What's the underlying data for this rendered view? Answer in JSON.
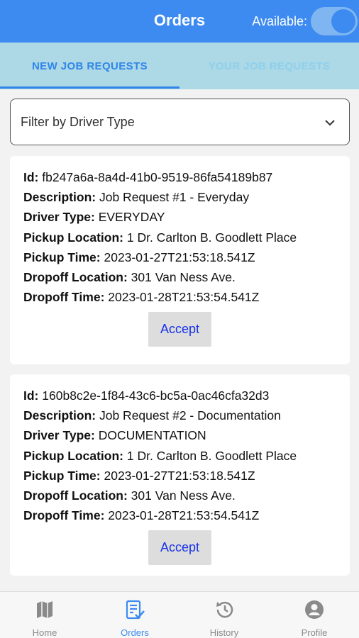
{
  "header": {
    "title": "Orders",
    "available_label": "Available:",
    "available_on": true
  },
  "tabs": [
    {
      "label": "NEW JOB REQUESTS",
      "active": true
    },
    {
      "label": "YOUR JOB REQUESTS",
      "active": false
    }
  ],
  "filter": {
    "placeholder": "Filter by Driver Type"
  },
  "jobs": [
    {
      "id_label": "Id:",
      "id": "fb247a6a-8a4d-41b0-9519-86fa54189b87",
      "description_label": "Description:",
      "description": "Job Request #1 - Everyday",
      "driver_type_label": "Driver Type:",
      "driver_type": "EVERYDAY",
      "pickup_location_label": "Pickup Location:",
      "pickup_location": "1 Dr. Carlton B. Goodlett Place",
      "pickup_time_label": "Pickup Time:",
      "pickup_time": "2023-01-27T21:53:18.541Z",
      "dropoff_location_label": "Dropoff Location:",
      "dropoff_location": "301 Van Ness Ave.",
      "dropoff_time_label": "Dropoff Time:",
      "dropoff_time": "2023-01-28T21:53:54.541Z",
      "accept_label": "Accept"
    },
    {
      "id_label": "Id:",
      "id": "160b8c2e-1f84-43c6-bc5a-0ac46cfa32d3",
      "description_label": "Description:",
      "description": "Job Request #2 - Documentation",
      "driver_type_label": "Driver Type:",
      "driver_type": "DOCUMENTATION",
      "pickup_location_label": "Pickup Location:",
      "pickup_location": "1 Dr. Carlton B. Goodlett Place",
      "pickup_time_label": "Pickup Time:",
      "pickup_time": "2023-01-27T21:53:18.541Z",
      "dropoff_location_label": "Dropoff Location:",
      "dropoff_location": "301 Van Ness Ave.",
      "dropoff_time_label": "Dropoff Time:",
      "dropoff_time": "2023-01-28T21:53:54.541Z",
      "accept_label": "Accept"
    }
  ],
  "bottom_nav": [
    {
      "label": "Home",
      "icon": "map-icon",
      "active": false
    },
    {
      "label": "Orders",
      "icon": "orders-check-icon",
      "active": true
    },
    {
      "label": "History",
      "icon": "history-icon",
      "active": false
    },
    {
      "label": "Profile",
      "icon": "profile-icon",
      "active": false
    }
  ],
  "colors": {
    "primary": "#3d8bf0",
    "tab_bar": "#add8e6",
    "accept_text": "#1a33e6"
  }
}
